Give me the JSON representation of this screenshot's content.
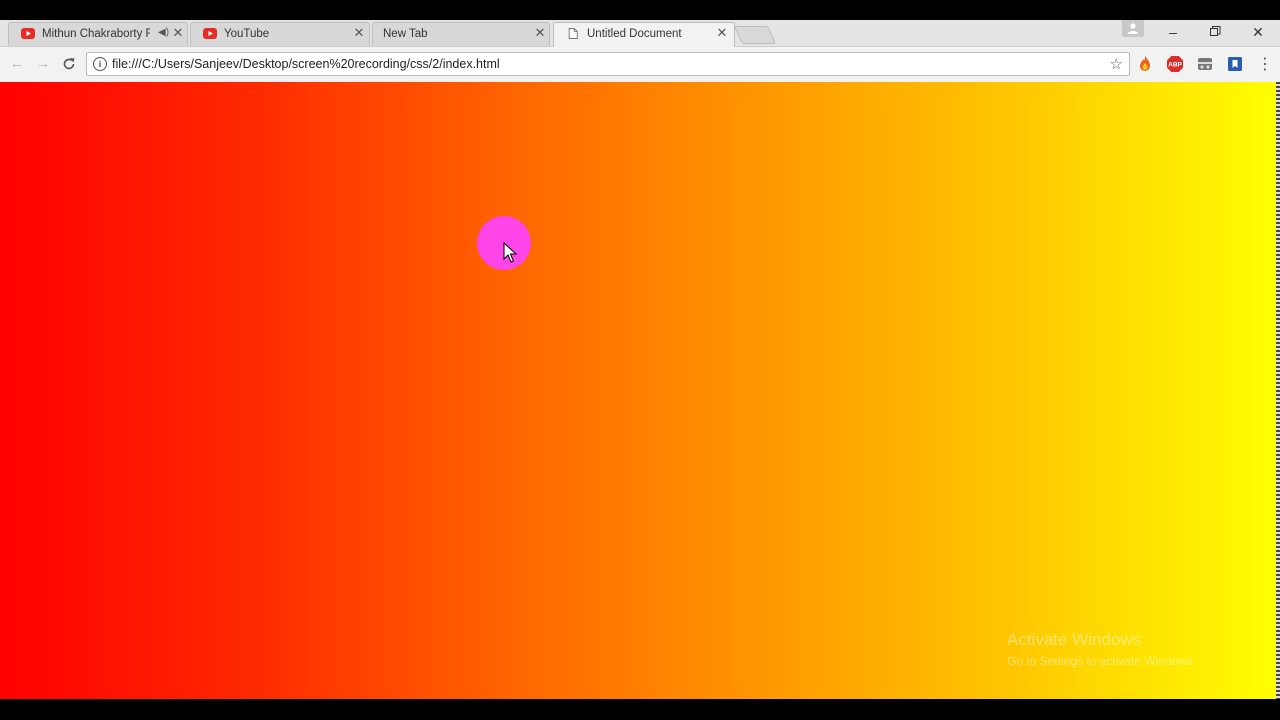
{
  "tabs": [
    {
      "title": "Mithun Chakraborty F",
      "favicon": "youtube-icon",
      "audio": "speaker-icon"
    },
    {
      "title": "YouTube",
      "favicon": "youtube-icon"
    },
    {
      "title": "New Tab",
      "favicon": ""
    },
    {
      "title": "Untitled Document",
      "favicon": "document-icon",
      "active": true
    }
  ],
  "toolbar": {
    "url": "file:///C:/Users/Sanjeev/Desktop/screen%20recording/css/2/index.html"
  },
  "extensions": [
    "fire-extension-icon",
    "adblock-plus-icon",
    "incognito-extension-icon",
    "bookmark-extension-icon"
  ],
  "extension_labels": {
    "adblock": "ABP"
  },
  "page": {
    "background_start": "#ff0000",
    "background_end": "#ffff00",
    "circle_color": "#ff44e8"
  },
  "watermark": {
    "line1": "Activate Windows",
    "line2": "Go to Settings to activate Windows."
  },
  "colors": {
    "youtube_red": "#e52d27",
    "chrome_bg": "#f2f2f2"
  }
}
